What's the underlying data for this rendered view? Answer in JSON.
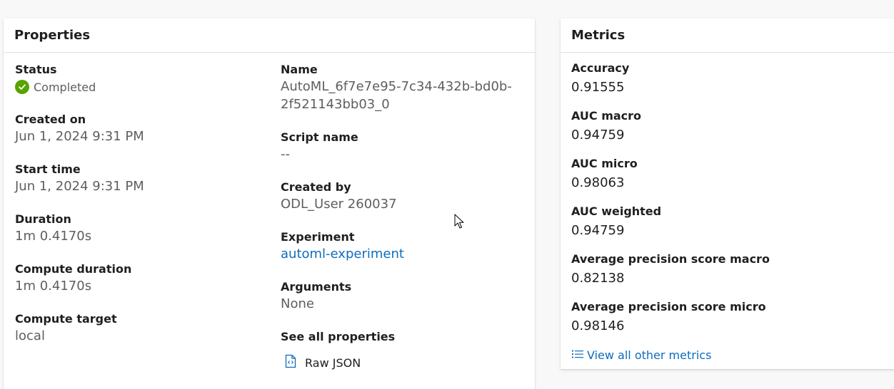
{
  "properties": {
    "title": "Properties",
    "left": [
      {
        "label": "Status",
        "value": "Completed"
      },
      {
        "label": "Created on",
        "value": "Jun 1, 2024 9:31 PM"
      },
      {
        "label": "Start time",
        "value": "Jun 1, 2024 9:31 PM"
      },
      {
        "label": "Duration",
        "value": "1m 0.4170s"
      },
      {
        "label": "Compute duration",
        "value": "1m 0.4170s"
      },
      {
        "label": "Compute target",
        "value": "local"
      }
    ],
    "right": {
      "name_label": "Name",
      "name_line1": "AutoML_6f7e7e95-7c34-432b-bd0b-",
      "name_line2": "2f521143bb03_0",
      "script_label": "Script name",
      "script_value": "--",
      "created_by_label": "Created by",
      "created_by_value": "ODL_User 260037",
      "experiment_label": "Experiment",
      "experiment_value": "automl-experiment",
      "arguments_label": "Arguments",
      "arguments_value": "None",
      "see_all_label": "See all properties",
      "raw_json_label": "Raw JSON"
    }
  },
  "metrics": {
    "title": "Metrics",
    "items": [
      {
        "label": "Accuracy",
        "value": "0.91555"
      },
      {
        "label": "AUC macro",
        "value": "0.94759"
      },
      {
        "label": "AUC micro",
        "value": "0.98063"
      },
      {
        "label": "AUC weighted",
        "value": "0.94759"
      },
      {
        "label": "Average precision score macro",
        "value": "0.82138"
      },
      {
        "label": "Average precision score micro",
        "value": "0.98146"
      }
    ],
    "view_all_label": "View all other metrics"
  },
  "colors": {
    "accent": "#0f6cbd",
    "success": "#57a300"
  }
}
